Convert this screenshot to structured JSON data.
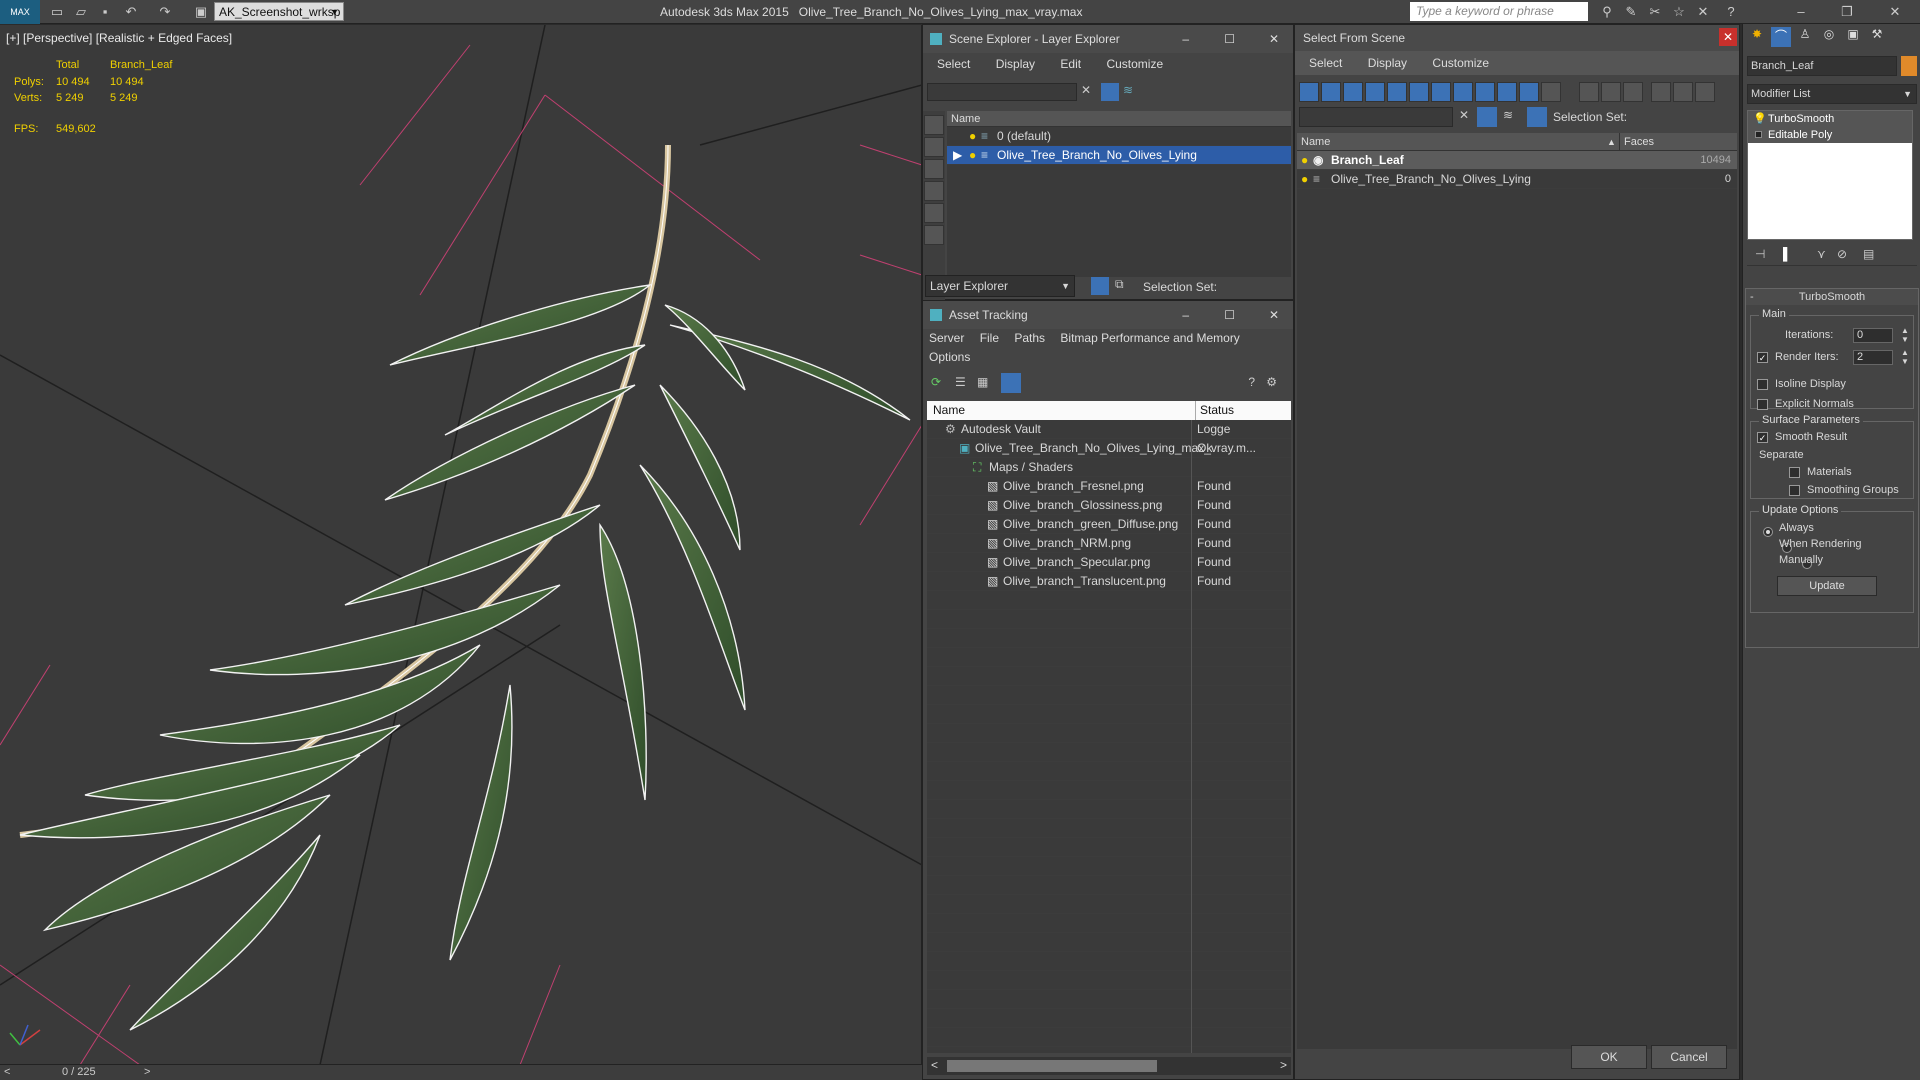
{
  "titlebar": {
    "logo": "MAX",
    "workspace": "AK_Screenshot_wrksp",
    "app_title": "Autodesk 3ds Max  2015",
    "file_title": "Olive_Tree_Branch_No_Olives_Lying_max_vray.max",
    "search_placeholder": "Type a keyword or phrase"
  },
  "viewport": {
    "label": "[+] [Perspective] [Realistic + Edged Faces]",
    "stats": {
      "col_total": "Total",
      "col_object": "Branch_Leaf",
      "polys_label": "Polys:",
      "polys_total": "10 494",
      "polys_object": "10 494",
      "verts_label": "Verts:",
      "verts_total": "5 249",
      "verts_object": "5 249",
      "fps_label": "FPS:",
      "fps_value": "549,602"
    },
    "trackbar": "0 / 225"
  },
  "scene_explorer": {
    "title": "Scene Explorer - Layer Explorer",
    "menu": [
      "Select",
      "Display",
      "Edit",
      "Customize"
    ],
    "col_name": "Name",
    "rows": [
      {
        "label": "0 (default)",
        "selected": false
      },
      {
        "label": "Olive_Tree_Branch_No_Olives_Lying",
        "selected": true
      }
    ],
    "footer_dropdown": "Layer Explorer",
    "selection_set_label": "Selection Set:"
  },
  "asset_tracking": {
    "title": "Asset Tracking",
    "menu": [
      "Server",
      "File",
      "Paths",
      "Bitmap Performance and Memory",
      "Options"
    ],
    "col_name": "Name",
    "col_status": "Status",
    "rows": [
      {
        "name": "Autodesk Vault",
        "status": "Logge",
        "indent": 0
      },
      {
        "name": "Olive_Tree_Branch_No_Olives_Lying_max_vray.m...",
        "status": "Ok",
        "indent": 1
      },
      {
        "name": "Maps / Shaders",
        "status": "",
        "indent": 2
      },
      {
        "name": "Olive_branch_Fresnel.png",
        "status": "Found",
        "indent": 3
      },
      {
        "name": "Olive_branch_Glossiness.png",
        "status": "Found",
        "indent": 3
      },
      {
        "name": "Olive_branch_green_Diffuse.png",
        "status": "Found",
        "indent": 3
      },
      {
        "name": "Olive_branch_NRM.png",
        "status": "Found",
        "indent": 3
      },
      {
        "name": "Olive_branch_Specular.png",
        "status": "Found",
        "indent": 3
      },
      {
        "name": "Olive_branch_Translucent.png",
        "status": "Found",
        "indent": 3
      }
    ]
  },
  "select_from_scene": {
    "title": "Select From Scene",
    "menu": [
      "Select",
      "Display",
      "Customize"
    ],
    "selection_set_label": "Selection Set:",
    "col_name": "Name",
    "col_faces": "Faces",
    "rows": [
      {
        "name": "Branch_Leaf",
        "faces": "10494",
        "selected": true
      },
      {
        "name": "Olive_Tree_Branch_No_Olives_Lying",
        "faces": "0",
        "selected": false
      }
    ],
    "ok_label": "OK",
    "cancel_label": "Cancel"
  },
  "command_panel": {
    "object_name": "Branch_Leaf",
    "modifier_list": "Modifier List",
    "stack": [
      "TurboSmooth",
      "Editable Poly"
    ],
    "rollout_title": "TurboSmooth",
    "main_label": "Main",
    "iterations_label": "Iterations:",
    "iterations_value": "0",
    "render_iters_label": "Render Iters:",
    "render_iters_value": "2",
    "isoline_label": "Isoline Display",
    "explicit_normals_label": "Explicit Normals",
    "surface_params_label": "Surface Parameters",
    "smooth_result_label": "Smooth Result",
    "separate_label": "Separate",
    "materials_label": "Materials",
    "smoothing_groups_label": "Smoothing Groups",
    "update_options_label": "Update Options",
    "always_label": "Always",
    "when_rendering_label": "When Rendering",
    "manually_label": "Manually",
    "update_button": "Update"
  }
}
